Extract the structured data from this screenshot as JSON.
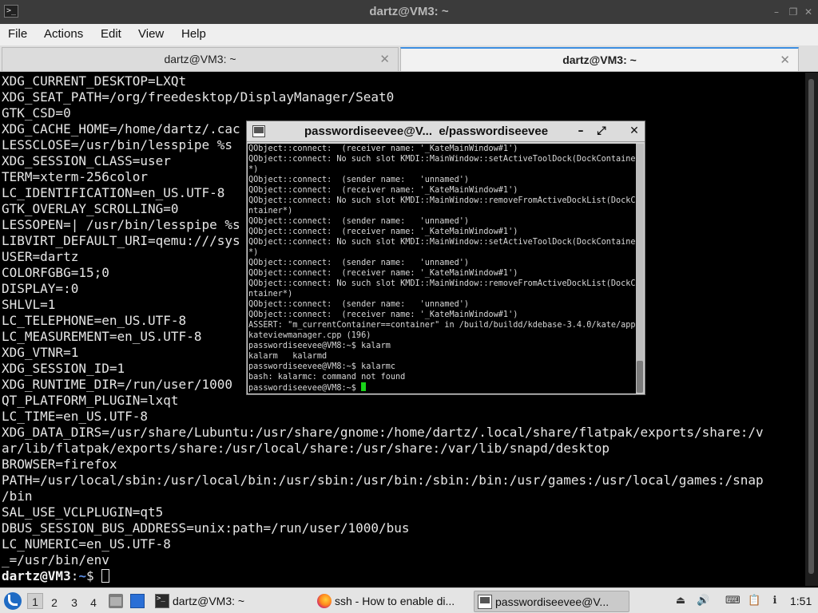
{
  "window": {
    "title": "dartz@VM3: ~",
    "minimize_glyph": "–",
    "maximize_glyph": "❐",
    "close_glyph": "✕"
  },
  "menu": [
    "File",
    "Actions",
    "Edit",
    "View",
    "Help"
  ],
  "tabs": [
    {
      "label": "dartz@VM3: ~",
      "active": false
    },
    {
      "label": "dartz@VM3: ~",
      "active": true
    }
  ],
  "terminal": {
    "lines": [
      "XDG_CURRENT_DESKTOP=LXQt",
      "XDG_SEAT_PATH=/org/freedesktop/DisplayManager/Seat0",
      "GTK_CSD=0",
      "XDG_CACHE_HOME=/home/dartz/.cac",
      "LESSCLOSE=/usr/bin/lesspipe %s",
      "XDG_SESSION_CLASS=user",
      "TERM=xterm-256color",
      "LC_IDENTIFICATION=en_US.UTF-8",
      "GTK_OVERLAY_SCROLLING=0",
      "LESSOPEN=| /usr/bin/lesspipe %s",
      "LIBVIRT_DEFAULT_URI=qemu:///sys",
      "USER=dartz",
      "COLORFGBG=15;0",
      "DISPLAY=:0",
      "SHLVL=1",
      "LC_TELEPHONE=en_US.UTF-8",
      "LC_MEASUREMENT=en_US.UTF-8",
      "XDG_VTNR=1",
      "XDG_SESSION_ID=1",
      "XDG_RUNTIME_DIR=/run/user/1000",
      "QT_PLATFORM_PLUGIN=lxqt",
      "LC_TIME=en_US.UTF-8",
      "XDG_DATA_DIRS=/usr/share/Lubuntu:/usr/share/gnome:/home/dartz/.local/share/flatpak/exports/share:/v",
      "ar/lib/flatpak/exports/share:/usr/local/share:/usr/share:/var/lib/snapd/desktop",
      "BROWSER=firefox",
      "PATH=/usr/local/sbin:/usr/local/bin:/usr/sbin:/usr/bin:/sbin:/bin:/usr/games:/usr/local/games:/snap",
      "/bin",
      "SAL_USE_VCLPLUGIN=qt5",
      "DBUS_SESSION_BUS_ADDRESS=unix:path=/run/user/1000/bus",
      "LC_NUMERIC=en_US.UTF-8",
      "_=/usr/bin/env"
    ],
    "prompt_user": "dartz@VM3",
    "prompt_sep": ":",
    "prompt_dir": "~",
    "prompt_symbol": "$ "
  },
  "xterm": {
    "title": "passwordiseevee@V...  e/passwordiseevee",
    "lines": [
      "QObject::connect:  (receiver name: '_KateMainWindow#1')",
      "QObject::connect: No such slot KMDI::MainWindow::setActiveToolDock(DockContainer",
      "*)",
      "QObject::connect:  (sender name:   'unnamed')",
      "QObject::connect:  (receiver name: '_KateMainWindow#1')",
      "QObject::connect: No such slot KMDI::MainWindow::removeFromActiveDockList(DockCo",
      "ntainer*)",
      "QObject::connect:  (sender name:   'unnamed')",
      "QObject::connect:  (receiver name: '_KateMainWindow#1')",
      "QObject::connect: No such slot KMDI::MainWindow::setActiveToolDock(DockContainer",
      "*)",
      "QObject::connect:  (sender name:   'unnamed')",
      "QObject::connect:  (receiver name: '_KateMainWindow#1')",
      "QObject::connect: No such slot KMDI::MainWindow::removeFromActiveDockList(DockCo",
      "ntainer*)",
      "QObject::connect:  (sender name:   'unnamed')",
      "QObject::connect:  (receiver name: '_KateMainWindow#1')",
      "ASSERT: \"m_currentContainer==container\" in /build/buildd/kdebase-3.4.0/kate/app/",
      "kateviewmanager.cpp (196)",
      "passwordiseevee@VM8:~$ kalarm",
      "kalarm   kalarmd",
      "passwordiseevee@VM8:~$ kalarmc",
      "bash: kalarmc: command not found"
    ],
    "prompt": "passwordiseevee@VM8:~$ ",
    "cursor_color": "#19d219"
  },
  "taskbar": {
    "workspaces": [
      "1",
      "2",
      "3",
      "4"
    ],
    "active_workspace": "1",
    "tasks": [
      {
        "label": "dartz@VM3: ~",
        "icon": "terminal-icon"
      },
      {
        "label": "ssh - How to enable di...",
        "icon": "firefox-icon"
      },
      {
        "label": "passwordiseevee@V...",
        "icon": "xterm-icon"
      }
    ],
    "clock": "1:51"
  }
}
